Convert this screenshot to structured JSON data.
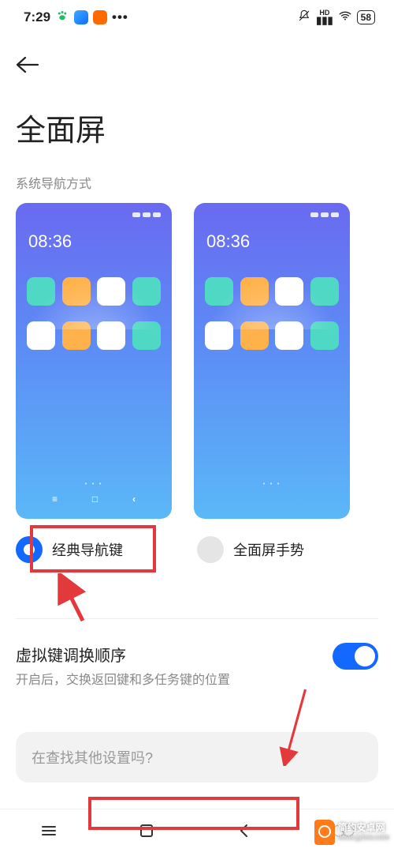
{
  "status_bar": {
    "time": "7:29",
    "battery": "58"
  },
  "page": {
    "title": "全面屏",
    "section_label": "系统导航方式"
  },
  "preview": {
    "time": "08:36"
  },
  "options": {
    "classic": "经典导航键",
    "gesture": "全面屏手势"
  },
  "toggle": {
    "title": "虚拟键调换顺序",
    "subtitle": "开启后，交换返回键和多任务键的位置",
    "on": true
  },
  "search": {
    "placeholder": "在查找其他设置吗?"
  },
  "watermark": {
    "name": "简约安卓网",
    "url": "www.jylzw.com"
  },
  "icon_colors": {
    "row1": [
      "#4fd8c3",
      "#ffb24a",
      "#ffffff",
      "#4fd8c3"
    ],
    "row2": [
      "#ffffff",
      "#ffb24a",
      "#ffffff",
      "#4fd8c3"
    ]
  }
}
